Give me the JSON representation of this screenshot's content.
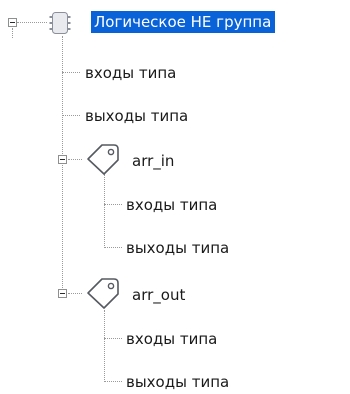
{
  "tree": {
    "root": {
      "label": "Логическое НЕ группа",
      "icon": "chip-icon",
      "selected": true,
      "expanded": true,
      "selection_color": "#0a62d8"
    },
    "root_children": [
      {
        "label": "входы типа"
      },
      {
        "label": "выходы типа"
      }
    ],
    "groups": [
      {
        "label": "arr_in",
        "icon": "tag-icon",
        "expanded": true,
        "children": [
          {
            "label": "входы типа"
          },
          {
            "label": "выходы типа"
          }
        ]
      },
      {
        "label": "arr_out",
        "icon": "tag-icon",
        "expanded": true,
        "children": [
          {
            "label": "входы типа"
          },
          {
            "label": "выходы типа"
          }
        ]
      }
    ]
  }
}
